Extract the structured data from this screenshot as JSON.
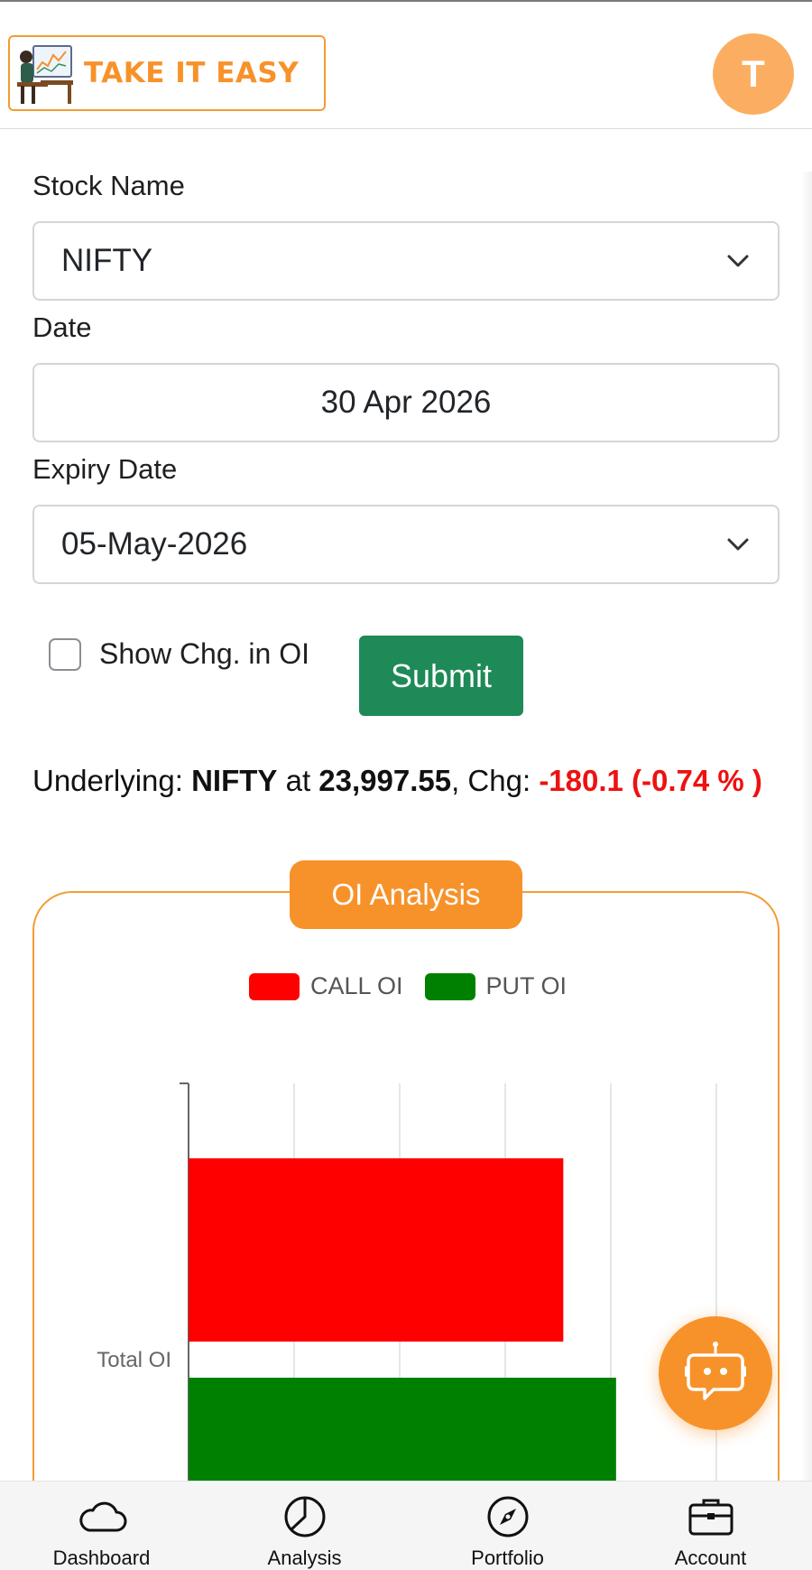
{
  "header": {
    "logo_text": "TAKE IT EASY",
    "avatar_initial": "T"
  },
  "form": {
    "stock_label": "Stock Name",
    "stock_value": "NIFTY",
    "date_label": "Date",
    "date_value": "30 Apr 2026",
    "expiry_label": "Expiry Date",
    "expiry_value": "05-May-2026",
    "checkbox_label": "Show Chg. in OI",
    "checkbox_checked": false,
    "submit_label": "Submit"
  },
  "underlying": {
    "prefix": "Underlying: ",
    "symbol": "NIFTY",
    "at": " at ",
    "price": "23,997.55",
    "chg_label": ", Chg: ",
    "change": "-180.1 (-0.74 % )"
  },
  "card": {
    "title": "OI Analysis"
  },
  "colors": {
    "accent": "#f7922a",
    "call": "#ff0000",
    "put": "#008000",
    "submit": "#1e8a57",
    "negative": "#ee1111"
  },
  "chart_data": {
    "type": "bar",
    "orientation": "horizontal",
    "categories": [
      "Total OI"
    ],
    "series": [
      {
        "name": "CALL OI",
        "values": [
          0.71
        ],
        "color": "#ff0000"
      },
      {
        "name": "PUT OI",
        "values": [
          0.81
        ],
        "color": "#008000"
      }
    ],
    "xlim": [
      0,
      1
    ],
    "grid": true,
    "legend": "top-center"
  },
  "bottom_nav": [
    {
      "label": "Dashboard",
      "icon": "cloud-icon"
    },
    {
      "label": "Analysis",
      "icon": "pie-chart-icon"
    },
    {
      "label": "Portfolio",
      "icon": "compass-icon"
    },
    {
      "label": "Account",
      "icon": "briefcase-icon"
    }
  ]
}
